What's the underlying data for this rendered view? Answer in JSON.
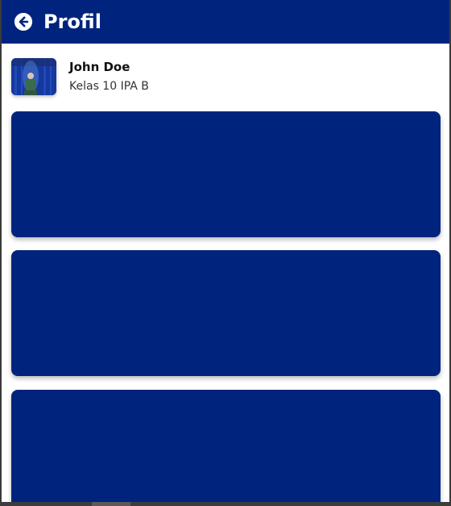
{
  "header": {
    "title": "Profil",
    "back_icon": "arrow-left-circle-icon",
    "background_color": "#00247d"
  },
  "profile": {
    "name": "John Doe",
    "class_name": "Kelas 10 IPA B",
    "avatar": "user-photo"
  },
  "cards": [
    {
      "color": "#00247d"
    },
    {
      "color": "#00247d"
    },
    {
      "color": "#00247d"
    }
  ]
}
